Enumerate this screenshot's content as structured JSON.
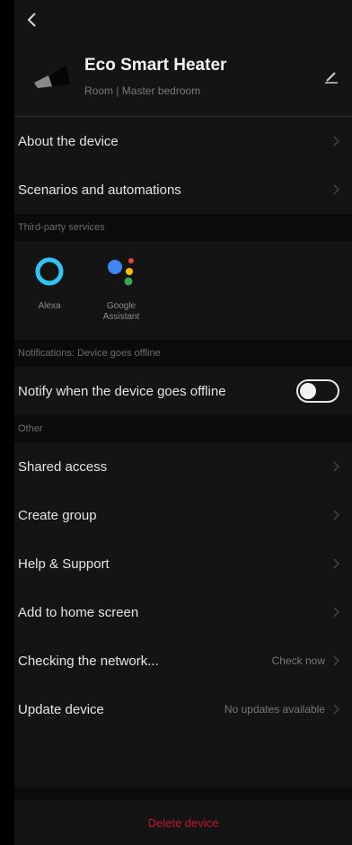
{
  "device": {
    "name": "Eco Smart Heater",
    "room": "Room | Master bedroom"
  },
  "menu_main": [
    {
      "label": "About the device"
    },
    {
      "label": "Scenarios and automations"
    }
  ],
  "third_party": {
    "header": "Third-party services",
    "items": [
      {
        "label": "Alexa",
        "icon": "alexa-icon"
      },
      {
        "label": "Google Assistant",
        "icon": "google-assistant-icon"
      }
    ]
  },
  "notifications": {
    "header": "Notifications: Device goes offline",
    "label": "Notify when the device goes offline",
    "enabled": false
  },
  "other": {
    "header": "Other",
    "items": [
      {
        "label": "Shared access",
        "value": ""
      },
      {
        "label": "Create group",
        "value": ""
      },
      {
        "label": "Help & Support",
        "value": ""
      },
      {
        "label": "Add to home screen",
        "value": ""
      },
      {
        "label": "Checking the network...",
        "value": "Check now"
      },
      {
        "label": "Update device",
        "value": "No updates available"
      }
    ]
  },
  "delete_label": "Delete device",
  "colors": {
    "background": "#141414",
    "section_bg": "#0b0b0b",
    "danger": "#c0182a",
    "alexa": "#31c4f3"
  }
}
